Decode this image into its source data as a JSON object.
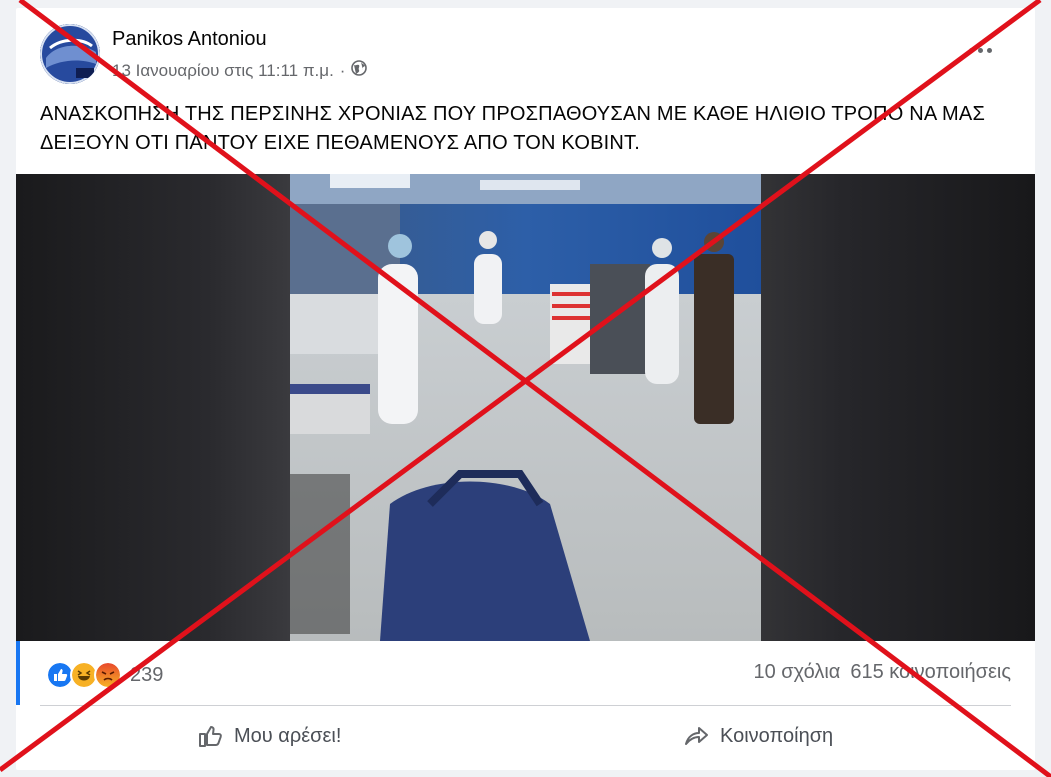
{
  "post": {
    "author": "Panikos Antoniou",
    "timestamp": "13 Ιανουαρίου στις 11:11 π.μ.",
    "separator": "·",
    "privacy_icon": "globe-icon",
    "text": "ΑΝΑΣΚΟΠΗΣΗ ΤΗΣ ΠΕΡΣΙΝΗΣ ΧΡΟΝΙΑΣ  ΠΟΥ ΠΡΟΣΠΑΘΟΥΣΑΝ ΜΕ ΚΑΘΕ ΗΛΙΘΙΟ ΤΡΟΠΟ ΝΑ ΜΑΣ ΔΕΙΞΟΥΝ ΟΤΙ ΠΑΝΤΟΥ ΕΙΧΕ ΠΕΘΑΜΕΝΟΥΣ ΑΠΟ ΤΟΝ ΚΟΒΙΝΤ."
  },
  "stats": {
    "reactions": [
      "like-icon",
      "haha-icon",
      "angry-icon"
    ],
    "reaction_count": "239",
    "comments": "10 σχόλια",
    "shares": "615 κοινοποιήσεις"
  },
  "actions": {
    "like_label": "Μου αρέσει!",
    "share_label": "Κοινοποίηση"
  },
  "colors": {
    "accent": "#1877f2",
    "overlay_cross": "#e0111b",
    "text_secondary": "#65676b"
  }
}
